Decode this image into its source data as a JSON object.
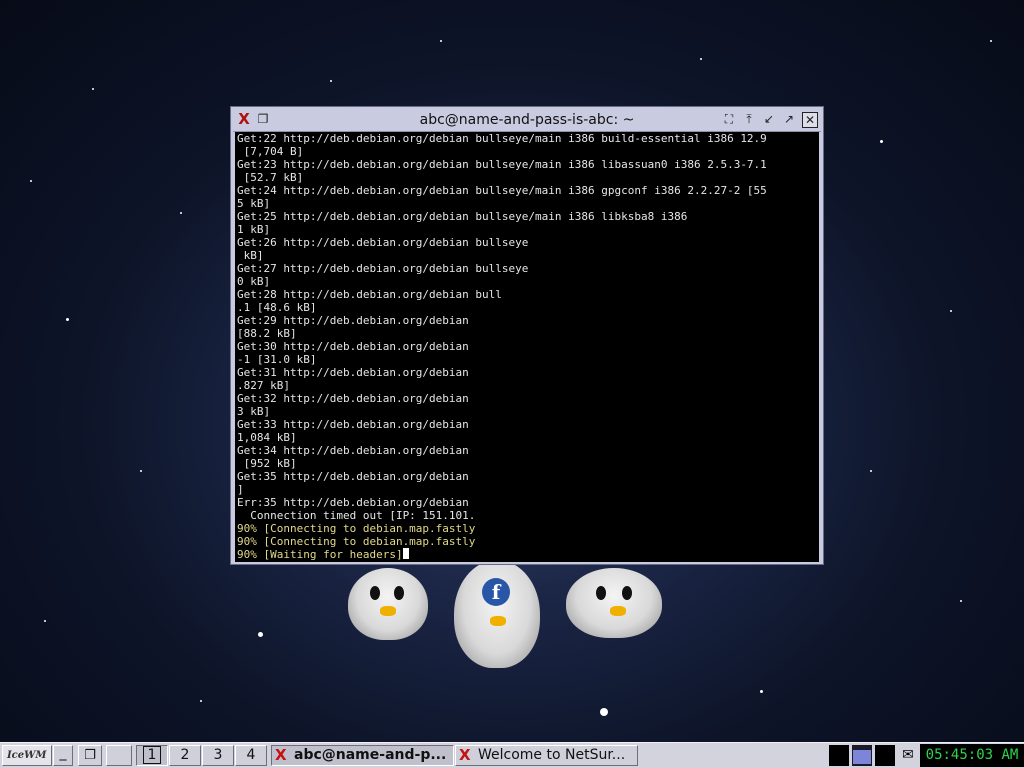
{
  "window": {
    "title": "abc@name-and-pass-is-abc: ~",
    "app_icon": "xterm-icon",
    "controls": [
      "fullscreen-icon",
      "raise-icon",
      "iconify-icon",
      "maximize-icon",
      "close-icon"
    ]
  },
  "terminal": {
    "lines": [
      {
        "text": "Get:22 http://deb.debian.org/debian bullseye/main i386 build-essential i386 12.9",
        "color": "default"
      },
      {
        "text": " [7,704 B]",
        "color": "default"
      },
      {
        "text": "Get:23 http://deb.debian.org/debian bullseye/main i386 libassuan0 i386 2.5.3-7.1",
        "color": "default"
      },
      {
        "text": " [52.7 kB]",
        "color": "default"
      },
      {
        "text": "Get:24 http://deb.debian.org/debian bullseye/main i386 gpgconf i386 2.2.27-2 [55",
        "color": "default"
      },
      {
        "text": "5 kB]",
        "color": "default"
      },
      {
        "text": "Get:25 http://deb.debian.org/debian bullseye/main i386 libksba8 i386",
        "color": "default"
      },
      {
        "text": "1 kB]",
        "color": "default"
      },
      {
        "text": "Get:26 http://deb.debian.org/debian bullseye",
        "color": "default"
      },
      {
        "text": " kB]",
        "color": "default"
      },
      {
        "text": "Get:27 http://deb.debian.org/debian bullseye",
        "color": "default"
      },
      {
        "text": "0 kB]",
        "color": "default"
      },
      {
        "text": "Get:28 http://deb.debian.org/debian bull",
        "color": "default"
      },
      {
        "text": ".1 [48.6 kB]",
        "color": "default"
      },
      {
        "text": "Get:29 http://deb.debian.org/debian",
        "color": "default"
      },
      {
        "text": "[88.2 kB]",
        "color": "default"
      },
      {
        "text": "Get:30 http://deb.debian.org/debian",
        "color": "default"
      },
      {
        "text": "-1 [31.0 kB]",
        "color": "default"
      },
      {
        "text": "Get:31 http://deb.debian.org/debian",
        "color": "default"
      },
      {
        "text": ".827 kB]",
        "color": "default"
      },
      {
        "text": "Get:32 http://deb.debian.org/debian",
        "color": "default"
      },
      {
        "text": "3 kB]",
        "color": "default"
      },
      {
        "text": "Get:33 http://deb.debian.org/debian",
        "color": "default"
      },
      {
        "text": "1,084 kB]",
        "color": "default"
      },
      {
        "text": "Get:34 http://deb.debian.org/debian",
        "color": "default"
      },
      {
        "text": " [952 kB]",
        "color": "default"
      },
      {
        "text": "Get:35 http://deb.debian.org/debian",
        "color": "default"
      },
      {
        "text": "]",
        "color": "default"
      },
      {
        "text": "Err:35 http://deb.debian.org/debian",
        "color": "default"
      },
      {
        "text": "  Connection timed out [IP: 151.101.",
        "color": "default"
      },
      {
        "text": "90% [Connecting to debian.map.fastly",
        "color": "yellow"
      },
      {
        "text": "90% [Connecting to debian.map.fastly",
        "color": "yellow"
      },
      {
        "text": "90% [Waiting for headers]",
        "color": "yellow",
        "cursor": true
      }
    ]
  },
  "taskbar": {
    "start_label": "IceWM",
    "show_desktop_icon": "minimize-all-icon",
    "window_list_icon": "window-list-icon",
    "workspaces": [
      "1",
      "2",
      "3",
      "4"
    ],
    "active_workspace": "1",
    "tasks": [
      {
        "label": "abc@name-and-p...",
        "icon": "xterm-icon",
        "active": true
      },
      {
        "label": "Welcome to NetSur...",
        "icon": "netsurf-icon",
        "active": false
      }
    ],
    "tray_icons": [
      "cpu-monitor-icon",
      "network-monitor-icon",
      "memory-monitor-icon",
      "mail-icon"
    ],
    "clock": "05:45:03 AM"
  },
  "colors": {
    "terminal_bg": "#000000",
    "terminal_fg": "#e6e6e6",
    "progress_fg": "#e2d98a",
    "clock_fg": "#31d24a",
    "titlebar_bg": "#c9cbe0"
  }
}
